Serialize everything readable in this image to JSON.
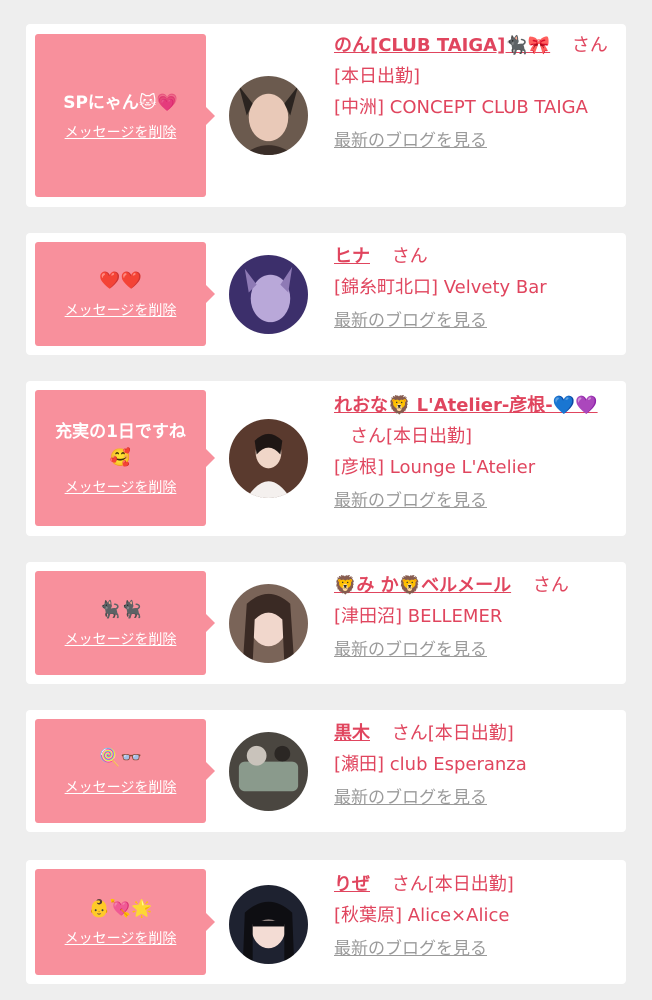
{
  "colors": {
    "accent": "#e0455e",
    "bubble": "#f8909c",
    "background": "#eeeeee",
    "card": "#ffffff",
    "link_gray": "#9a9a9a"
  },
  "items": [
    {
      "message": "SPにゃん🐱💗",
      "delete_label": "メッセージを削除",
      "name": "のん[CLUB TAIGA]🐈‍⬛🎀",
      "suffix": "さん",
      "status": "[本日出勤]",
      "shop": "[中洲] CONCEPT CLUB TAIGA",
      "blog_label": "最新のブログを見る"
    },
    {
      "message": "❤️❤️",
      "delete_label": "メッセージを削除",
      "name": "ヒナ",
      "suffix": "さん",
      "status": "",
      "shop": "[錦糸町北口] Velvety Bar",
      "blog_label": "最新のブログを見る"
    },
    {
      "message": "充実の1日ですね\n🥰",
      "delete_label": "メッセージを削除",
      "name": "れおな🦁 L'Atelier-彦根-💙💜",
      "suffix": "さん",
      "status": "[本日出勤]",
      "shop": "[彦根] Lounge L'Atelier",
      "blog_label": "最新のブログを見る"
    },
    {
      "message": "🐈‍⬛🐈‍⬛",
      "delete_label": "メッセージを削除",
      "name": "🦁み か🦁ベルメール",
      "suffix": "さん",
      "status": "",
      "shop": "[津田沼] BELLEMER",
      "blog_label": "最新のブログを見る"
    },
    {
      "message": "🍭👓",
      "delete_label": "メッセージを削除",
      "name": "黒木",
      "suffix": "さん",
      "status": "[本日出勤]",
      "shop": "[瀬田] club Esperanza",
      "blog_label": "最新のブログを見る"
    },
    {
      "message": "👶💘🌟",
      "delete_label": "メッセージを削除",
      "name": "りぜ",
      "suffix": "さん",
      "status": "[本日出勤]",
      "shop": "[秋葉原] Alice×Alice",
      "blog_label": "最新のブログを見る"
    }
  ]
}
